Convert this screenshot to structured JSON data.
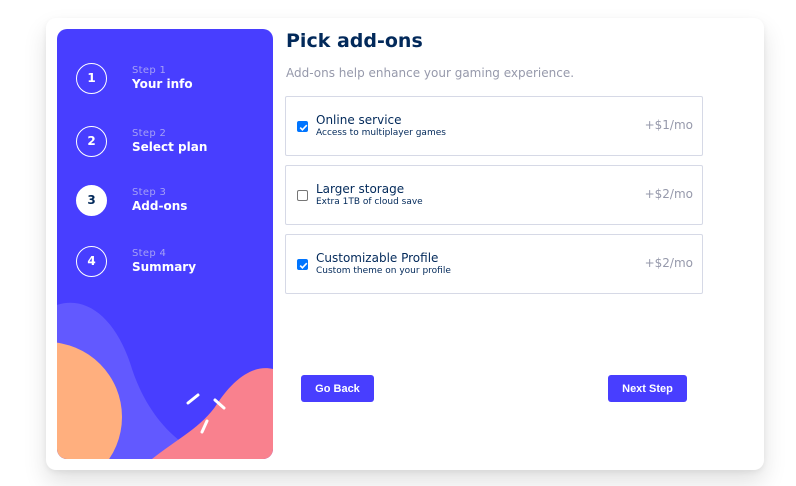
{
  "steps": [
    {
      "number": "1",
      "step_label": "Step 1",
      "title": "Your info",
      "active": false
    },
    {
      "number": "2",
      "step_label": "Step 2",
      "title": "Select plan",
      "active": false
    },
    {
      "number": "3",
      "step_label": "Step 3",
      "title": "Add-ons",
      "active": true
    },
    {
      "number": "4",
      "step_label": "Step 4",
      "title": "Summary",
      "active": false
    }
  ],
  "main": {
    "title": "Pick add-ons",
    "subtitle": "Add-ons help enhance your gaming experience."
  },
  "addons": [
    {
      "name": "Online service",
      "description": "Access to multiplayer games",
      "price": "+$1/mo",
      "checked": true
    },
    {
      "name": "Larger storage",
      "description": "Extra 1TB of cloud save",
      "price": "+$2/mo",
      "checked": false
    },
    {
      "name": "Customizable Profile",
      "description": "Custom theme on your profile",
      "price": "+$2/mo",
      "checked": true
    }
  ],
  "buttons": {
    "back_label": "Go Back",
    "next_label": "Next Step"
  },
  "colors": {
    "accent": "#483eff",
    "denim": "#02295a",
    "checkbox": "#0075ff",
    "orange": "#ffaf7e",
    "pink": "#f9818e",
    "purple_light": "#6259ff"
  }
}
